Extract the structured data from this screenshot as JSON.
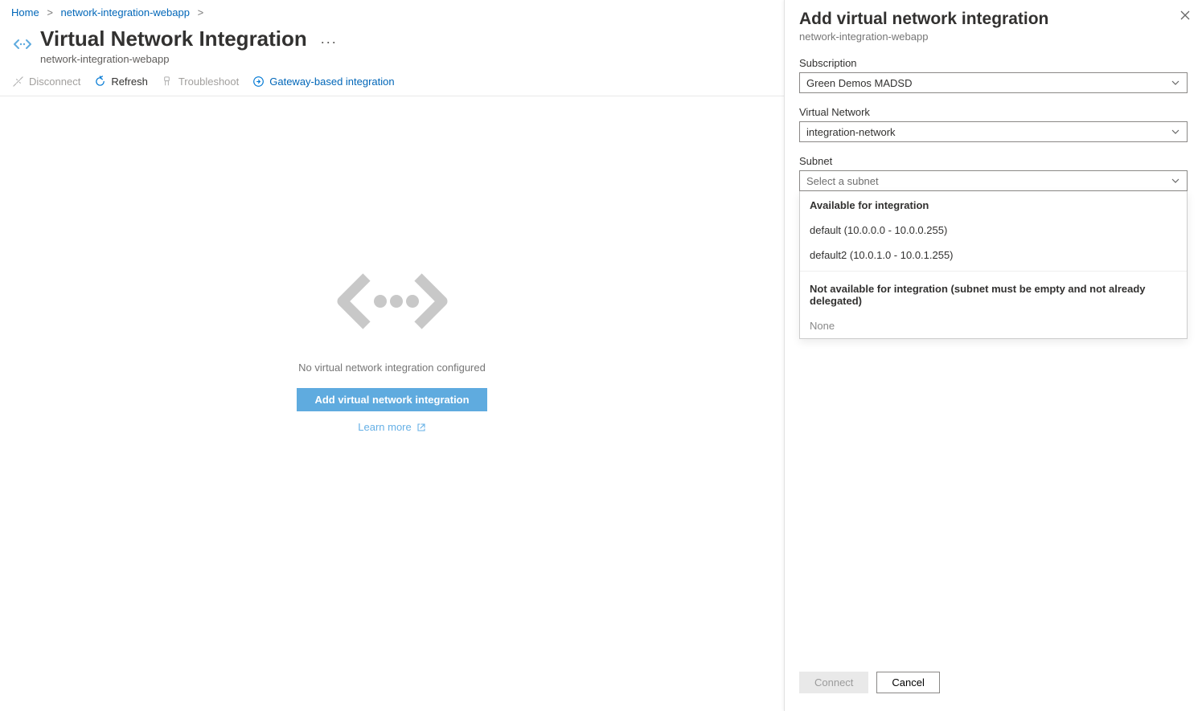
{
  "breadcrumb": {
    "home": "Home",
    "resource": "network-integration-webapp"
  },
  "header": {
    "title": "Virtual Network Integration",
    "subtitle": "network-integration-webapp",
    "more": "···"
  },
  "commands": {
    "disconnect": "Disconnect",
    "refresh": "Refresh",
    "troubleshoot": "Troubleshoot",
    "gateway": "Gateway-based integration"
  },
  "empty": {
    "message": "No virtual network integration configured",
    "button": "Add virtual network integration",
    "learn_more": "Learn more"
  },
  "flyout": {
    "title": "Add virtual network integration",
    "subtitle": "network-integration-webapp",
    "subscription_label": "Subscription",
    "subscription_value": "Green Demos MADSD",
    "vnet_label": "Virtual Network",
    "vnet_value": "integration-network",
    "subnet_label": "Subnet",
    "subnet_placeholder": "Select a subnet",
    "available_group": "Available for integration",
    "available_options": [
      "default (10.0.0.0 - 10.0.0.255)",
      "default2 (10.0.1.0 - 10.0.1.255)"
    ],
    "unavailable_group": "Not available for integration (subnet must be empty and not already delegated)",
    "unavailable_text": "None",
    "connect": "Connect",
    "cancel": "Cancel"
  }
}
